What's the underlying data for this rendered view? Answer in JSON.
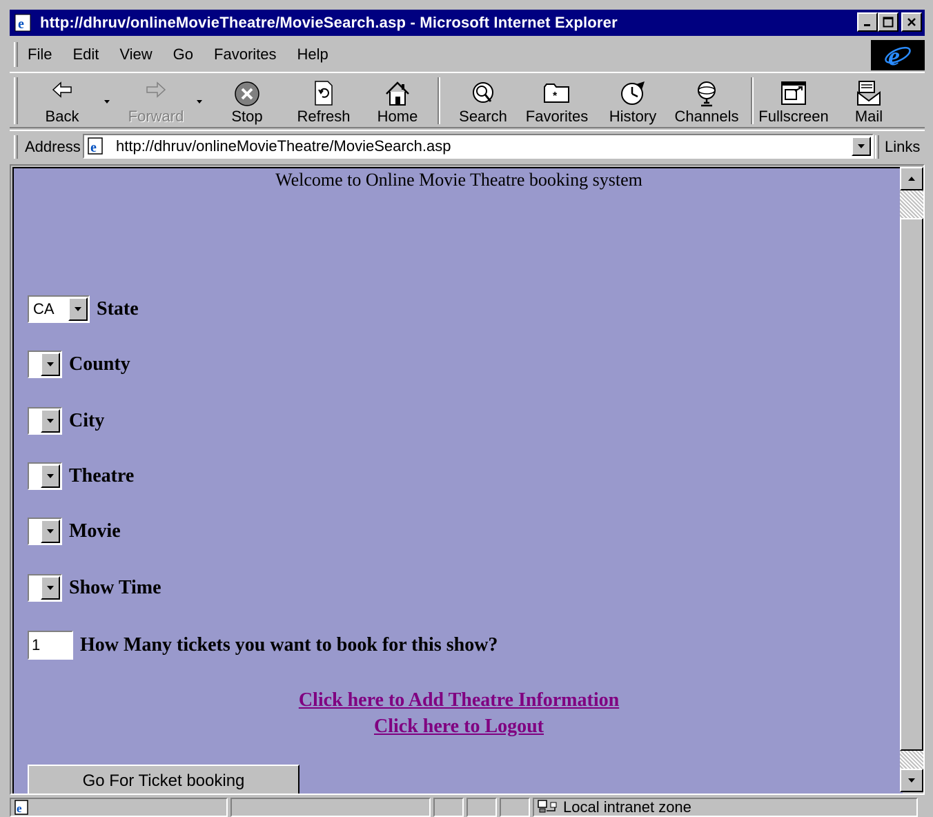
{
  "window": {
    "title": "http://dhruv/onlineMovieTheatre/MovieSearch.asp - Microsoft Internet Explorer",
    "minimize": "_",
    "maximize": "□",
    "close": "✕"
  },
  "menu": [
    "File",
    "Edit",
    "View",
    "Go",
    "Favorites",
    "Help"
  ],
  "toolbar": {
    "back": "Back",
    "forward": "Forward",
    "stop": "Stop",
    "refresh": "Refresh",
    "home": "Home",
    "search": "Search",
    "favorites": "Favorites",
    "history": "History",
    "channels": "Channels",
    "fullscreen": "Fullscreen",
    "mail": "Mail"
  },
  "address": {
    "label": "Address",
    "url": "http://dhruv/onlineMovieTheatre/MovieSearch.asp",
    "links_label": "Links"
  },
  "page": {
    "welcome": "Welcome to Online Movie Theatre booking system",
    "fields": {
      "state": {
        "label": "State",
        "value": "CA"
      },
      "county": {
        "label": "County",
        "value": ""
      },
      "city": {
        "label": "City",
        "value": ""
      },
      "theatre": {
        "label": "Theatre",
        "value": ""
      },
      "movie": {
        "label": "Movie",
        "value": ""
      },
      "showtime": {
        "label": "Show Time",
        "value": ""
      },
      "tickets": {
        "label": "How Many tickets you want to book for this show?",
        "value": "1"
      }
    },
    "links": {
      "add_theatre": "Click here to Add Theatre Information",
      "logout": "Click here to Logout"
    },
    "submit": "Go For Ticket booking"
  },
  "status": {
    "zone": "Local intranet zone"
  },
  "colors": {
    "page_bg": "#9999cc",
    "title_bar": "#000080",
    "link": "#800080",
    "chrome": "#c0c0c0"
  }
}
